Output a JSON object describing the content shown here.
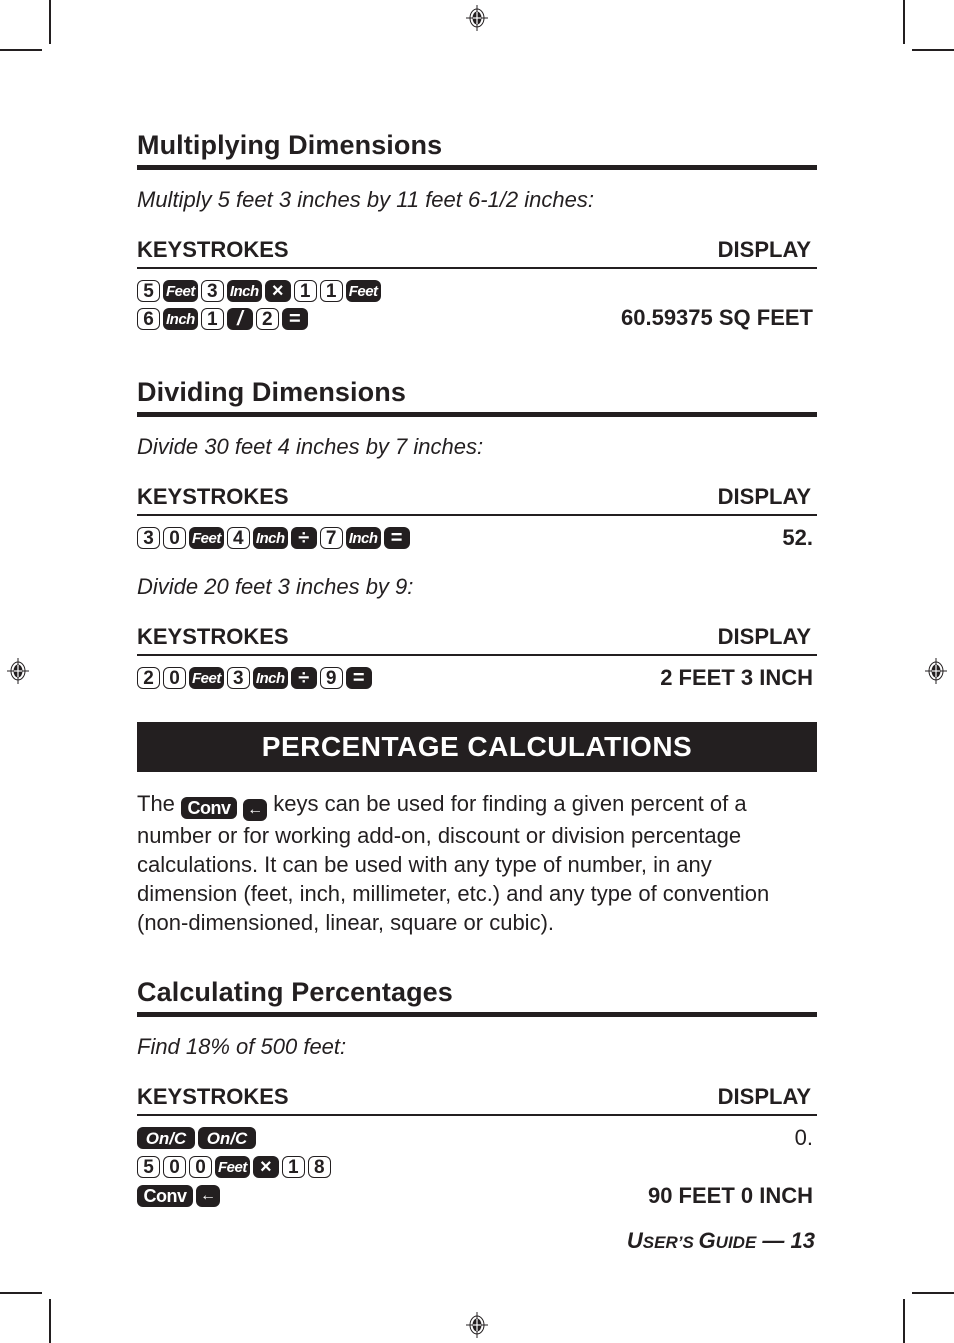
{
  "sections": {
    "multiplying": {
      "title": "Multiplying Dimensions",
      "example": "Multiply 5 feet 3 inches by 11 feet 6-1/2 inches:",
      "keystrokes_label": "KEYSTROKES",
      "display_label": "DISPLAY",
      "row1_keys": [
        "5",
        "Feet",
        "3",
        "Inch",
        "×",
        "1",
        "1",
        "Feet"
      ],
      "row2_keys": [
        "6",
        "Inch",
        "1",
        "/",
        "2",
        "="
      ],
      "display": "60.59375 SQ FEET"
    },
    "dividing": {
      "title": "Dividing Dimensions",
      "example1": "Divide 30 feet 4 inches by 7 inches:",
      "example1_keys": [
        "3",
        "0",
        "Feet",
        "4",
        "Inch",
        "÷",
        "7",
        "Inch",
        "="
      ],
      "example1_display": "52.",
      "example2": "Divide 20 feet 3 inches by 9:",
      "example2_keys": [
        "2",
        "0",
        "Feet",
        "3",
        "Inch",
        "÷",
        "9",
        "="
      ],
      "example2_display": "2 FEET 3 INCH",
      "keystrokes_label": "KEYSTROKES",
      "display_label": "DISPLAY"
    },
    "percentage": {
      "banner": "PERCENTAGE CALCULATIONS",
      "para_start": "The",
      "para_key1": "Conv",
      "para_key2": "←",
      "para_rest": "keys can be used for finding a given percent of a number or for working add-on, discount or division percentage calculations. It can be used with any type of number, in any dimension (feet, inch, millimeter, etc.) and any type of convention (non-dimensioned, linear, square or cubic)."
    },
    "calculating": {
      "title": "Calculating Percentages",
      "example": "Find 18% of 500 feet:",
      "keystrokes_label": "KEYSTROKES",
      "display_label": "DISPLAY",
      "row1_keys": [
        "On/C",
        "On/C"
      ],
      "row1_display": "0.",
      "row2_keys": [
        "5",
        "0",
        "0",
        "Feet",
        "×",
        "1",
        "8"
      ],
      "row3_keys": [
        "Conv",
        "←"
      ],
      "row3_display": "90 FEET 0 INCH"
    }
  },
  "footer": {
    "u": "U",
    "ser": "SER",
    "apos_s": "’S ",
    "g": "G",
    "uide": "UIDE",
    "suffix": " — 13"
  }
}
